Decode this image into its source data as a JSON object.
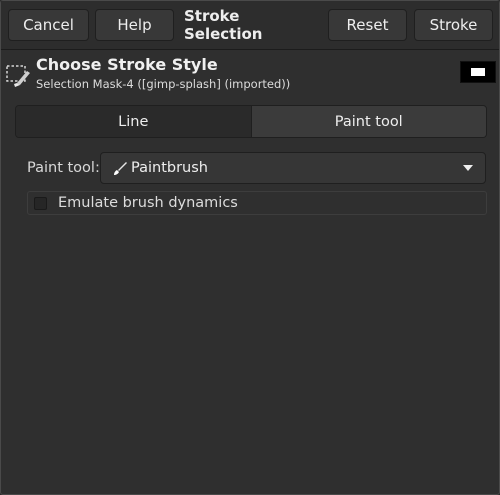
{
  "header_bar": {
    "cancel_label": "Cancel",
    "help_label": "Help",
    "title": "Stroke Selection",
    "reset_label": "Reset",
    "stroke_label": "Stroke"
  },
  "info": {
    "title": "Choose Stroke Style",
    "subtitle": "Selection Mask-4 ([gimp-splash] (imported))",
    "icon": "selection-icon"
  },
  "tabs": [
    {
      "label": "Line",
      "active": false
    },
    {
      "label": "Paint tool",
      "active": true
    }
  ],
  "paint_tool": {
    "label": "Paint tool:",
    "value": "Paintbrush",
    "icon": "paintbrush-icon"
  },
  "emulate": {
    "label": "Emulate brush dynamics",
    "checked": false
  },
  "colors": {
    "background": "#2f2f2f",
    "button_bg": "#383838",
    "text": "#eeeeee"
  }
}
